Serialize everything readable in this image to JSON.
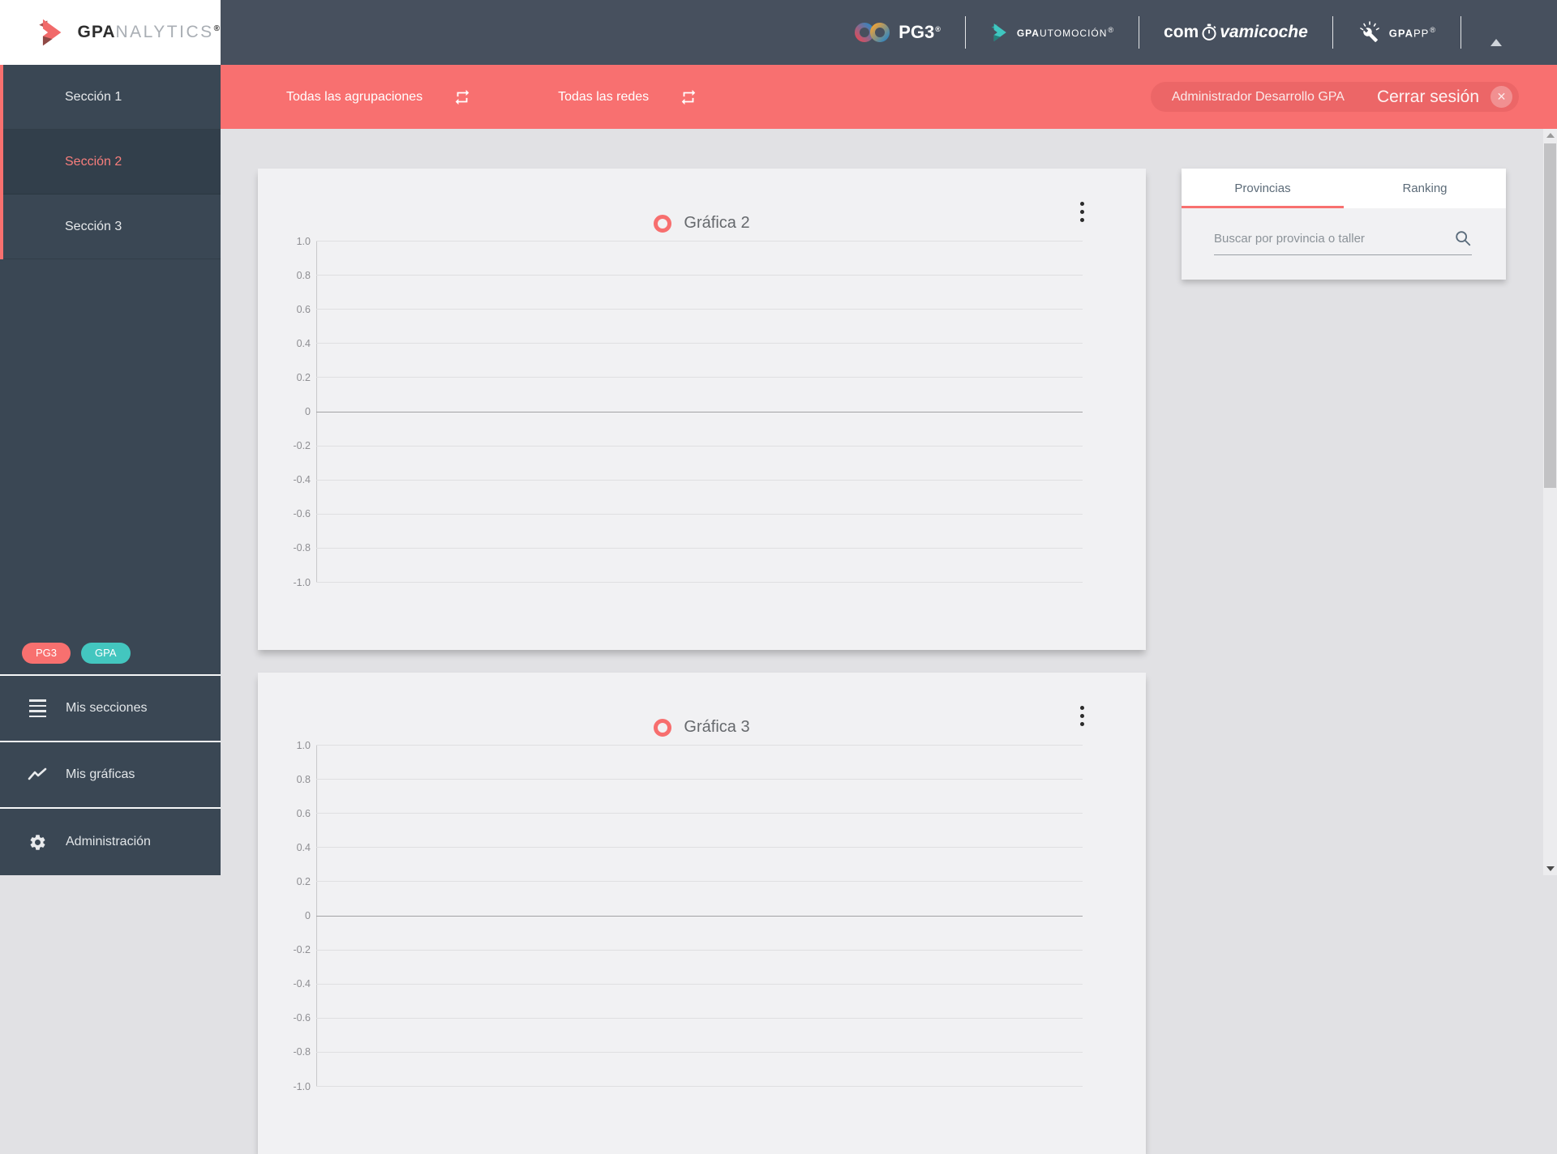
{
  "sidebar": {
    "logo": {
      "bold": "GPA",
      "light": "NALYTICS",
      "reg": "®"
    },
    "sections": [
      {
        "label": "Sección 1",
        "active": false
      },
      {
        "label": "Sección 2",
        "active": true
      },
      {
        "label": "Sección 3",
        "active": false
      }
    ],
    "badges": [
      {
        "label": "PG3",
        "color": "#f8706f"
      },
      {
        "label": "GPA",
        "color": "#43c6bf"
      }
    ],
    "menu": [
      {
        "label": "Mis secciones",
        "icon": "sections-list-icon"
      },
      {
        "label": "Mis gráficas",
        "icon": "line-chart-icon"
      },
      {
        "label": "Administración",
        "icon": "gear-icon"
      }
    ]
  },
  "header": {
    "brands": {
      "pg3": {
        "name": "PG3",
        "reg": "®",
        "icon": "infinity-icon"
      },
      "gpautomocion": {
        "bold": "GPA",
        "rest": "UTOMOCIÓN",
        "reg": "®",
        "icon": "arrow-logo-icon"
      },
      "comprovamicoche": {
        "pre": "com",
        "post": "vamicoche",
        "icon": "stopwatch-icon"
      },
      "gpapp": {
        "bold": "GPA",
        "rest": "PP",
        "reg": "®",
        "icon": "wrench-icon"
      }
    },
    "collapse": {
      "icon": "triangle-up-icon"
    },
    "bg_color": "#47505e"
  },
  "filterbar": {
    "bg_color": "#f87070",
    "filters": [
      {
        "label": "Todas las agrupaciones",
        "icon": "repeat-icon"
      },
      {
        "label": "Todas las redes",
        "icon": "repeat-icon"
      }
    ],
    "user_name": "Administrador Desarrollo GPA",
    "logout_label": "Cerrar sesión",
    "logout_icon": "x-circle-icon"
  },
  "panel": {
    "tabs": [
      {
        "label": "Provincias",
        "active": true
      },
      {
        "label": "Ranking",
        "active": false
      }
    ],
    "search_placeholder": "Buscar por provincia o taller",
    "search_icon": "search-icon",
    "accent_color": "#f8706f"
  },
  "chart_data": [
    {
      "type": "line",
      "title": "Gráfica 2",
      "legend": [
        "Gráfica 2"
      ],
      "legend_position": "top-center",
      "legend_marker_color": "#f76e6e",
      "series": [],
      "x": [],
      "ylim": [
        -1.0,
        1.0
      ],
      "yticks": [
        1.0,
        0.8,
        0.6,
        0.4,
        0.2,
        0,
        -0.2,
        -0.4,
        -0.6,
        -0.8,
        -1.0
      ],
      "ytick_labels": [
        "1.0",
        "0.8",
        "0.6",
        "0.4",
        "0.2",
        "0",
        "-0.2",
        "-0.4",
        "-0.6",
        "-0.8",
        "-1.0"
      ],
      "grid": true
    },
    {
      "type": "line",
      "title": "Gráfica 3",
      "legend": [
        "Gráfica 3"
      ],
      "legend_position": "top-center",
      "legend_marker_color": "#f76e6e",
      "series": [],
      "x": [],
      "ylim": [
        -1.0,
        1.0
      ],
      "yticks": [
        1.0,
        0.8,
        0.6,
        0.4,
        0.2,
        0,
        -0.2,
        -0.4,
        -0.6,
        -0.8,
        -1.0
      ],
      "ytick_labels": [
        "1.0",
        "0.8",
        "0.6",
        "0.4",
        "0.2",
        "0",
        "-0.2",
        "-0.4",
        "-0.6",
        "-0.8",
        "-1.0"
      ],
      "grid": true
    }
  ]
}
